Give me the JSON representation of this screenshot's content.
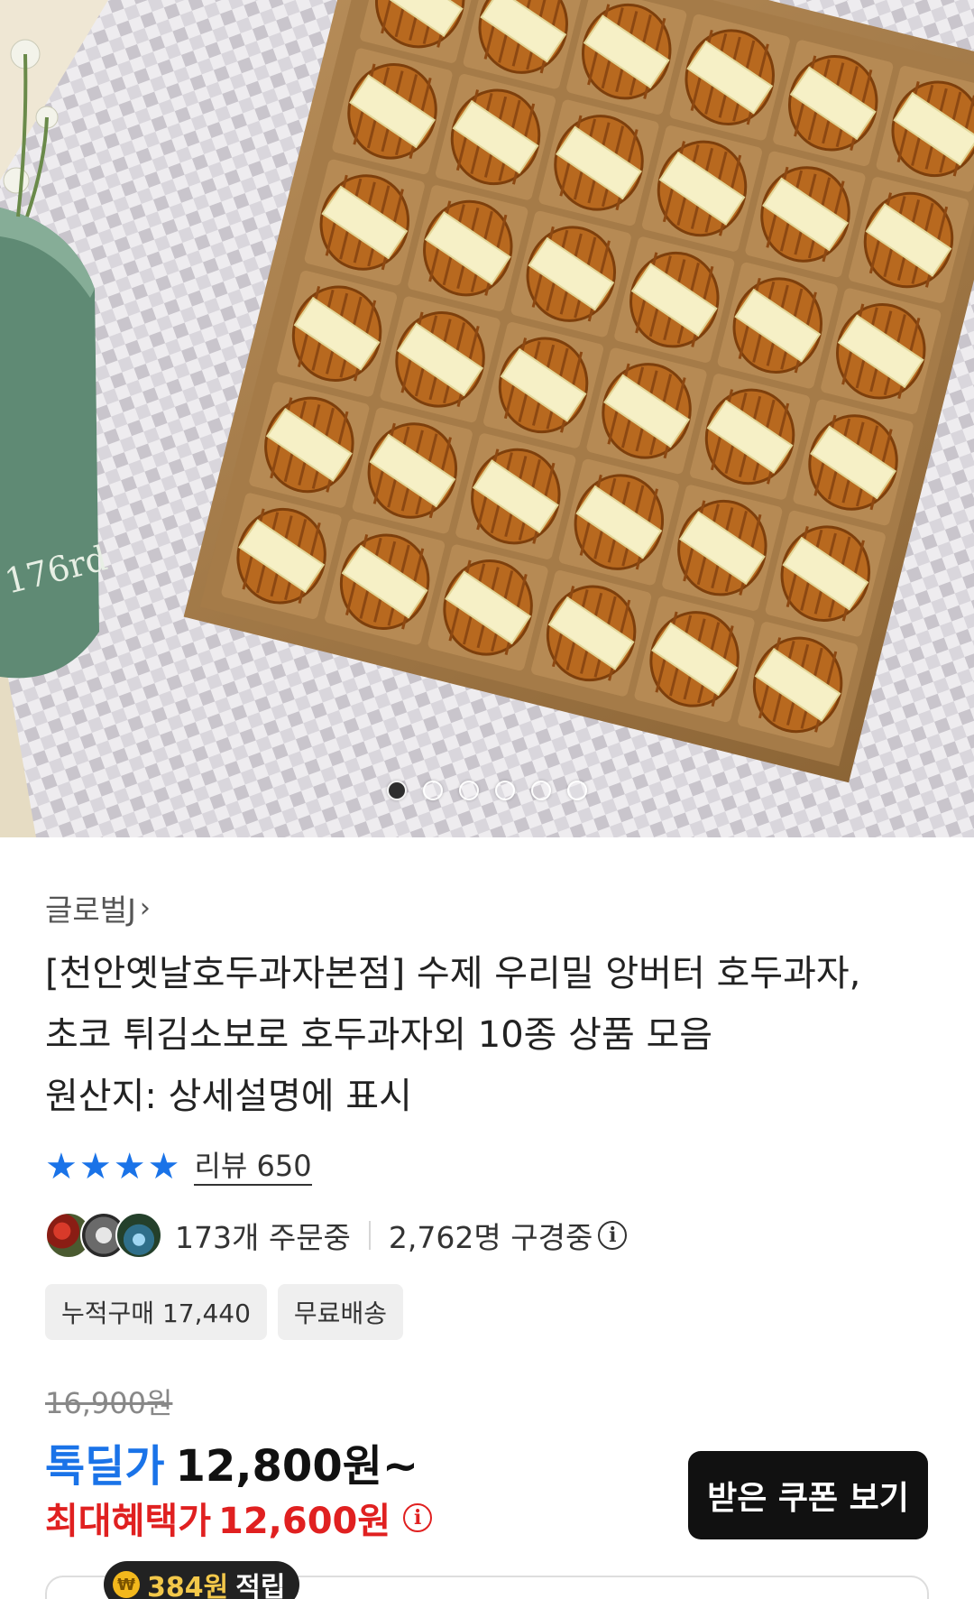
{
  "gallery": {
    "image_alt": "",
    "dot_count": 6,
    "active_index": 0,
    "tin_text": "176rd"
  },
  "seller": {
    "name": "글로벌J",
    "chevron": "›"
  },
  "product": {
    "title_line1": "[천안옛날호두과자본점] 수제 우리밀 앙버터 호두과자,",
    "title_line2": "초코 튀김소보로 호두과자외 10종 상품 모음",
    "origin": "원산지: 상세설명에 표시"
  },
  "rating": {
    "stars": 4,
    "star_glyph": "★",
    "review_label": "리뷰 650"
  },
  "social": {
    "ordering": "173개 주문중",
    "viewing": "2,762명 구경중",
    "info_glyph": "i"
  },
  "chips": [
    {
      "label": "누적구매 17,440"
    },
    {
      "label": "무료배송"
    }
  ],
  "price": {
    "original": "16,900원",
    "deal_label": "톡딜가",
    "deal_price": "12,800원~",
    "benefit_label": "최대혜택가",
    "benefit_price": "12,600원"
  },
  "coupon_button": {
    "label": "받은 쿠폰 보기"
  },
  "points": {
    "coin_glyph": "₩",
    "amount": "384원",
    "suffix": "적립"
  },
  "colors": {
    "accent_blue": "#1a73e8",
    "benefit_red": "#e02020",
    "button_black": "#111111"
  }
}
